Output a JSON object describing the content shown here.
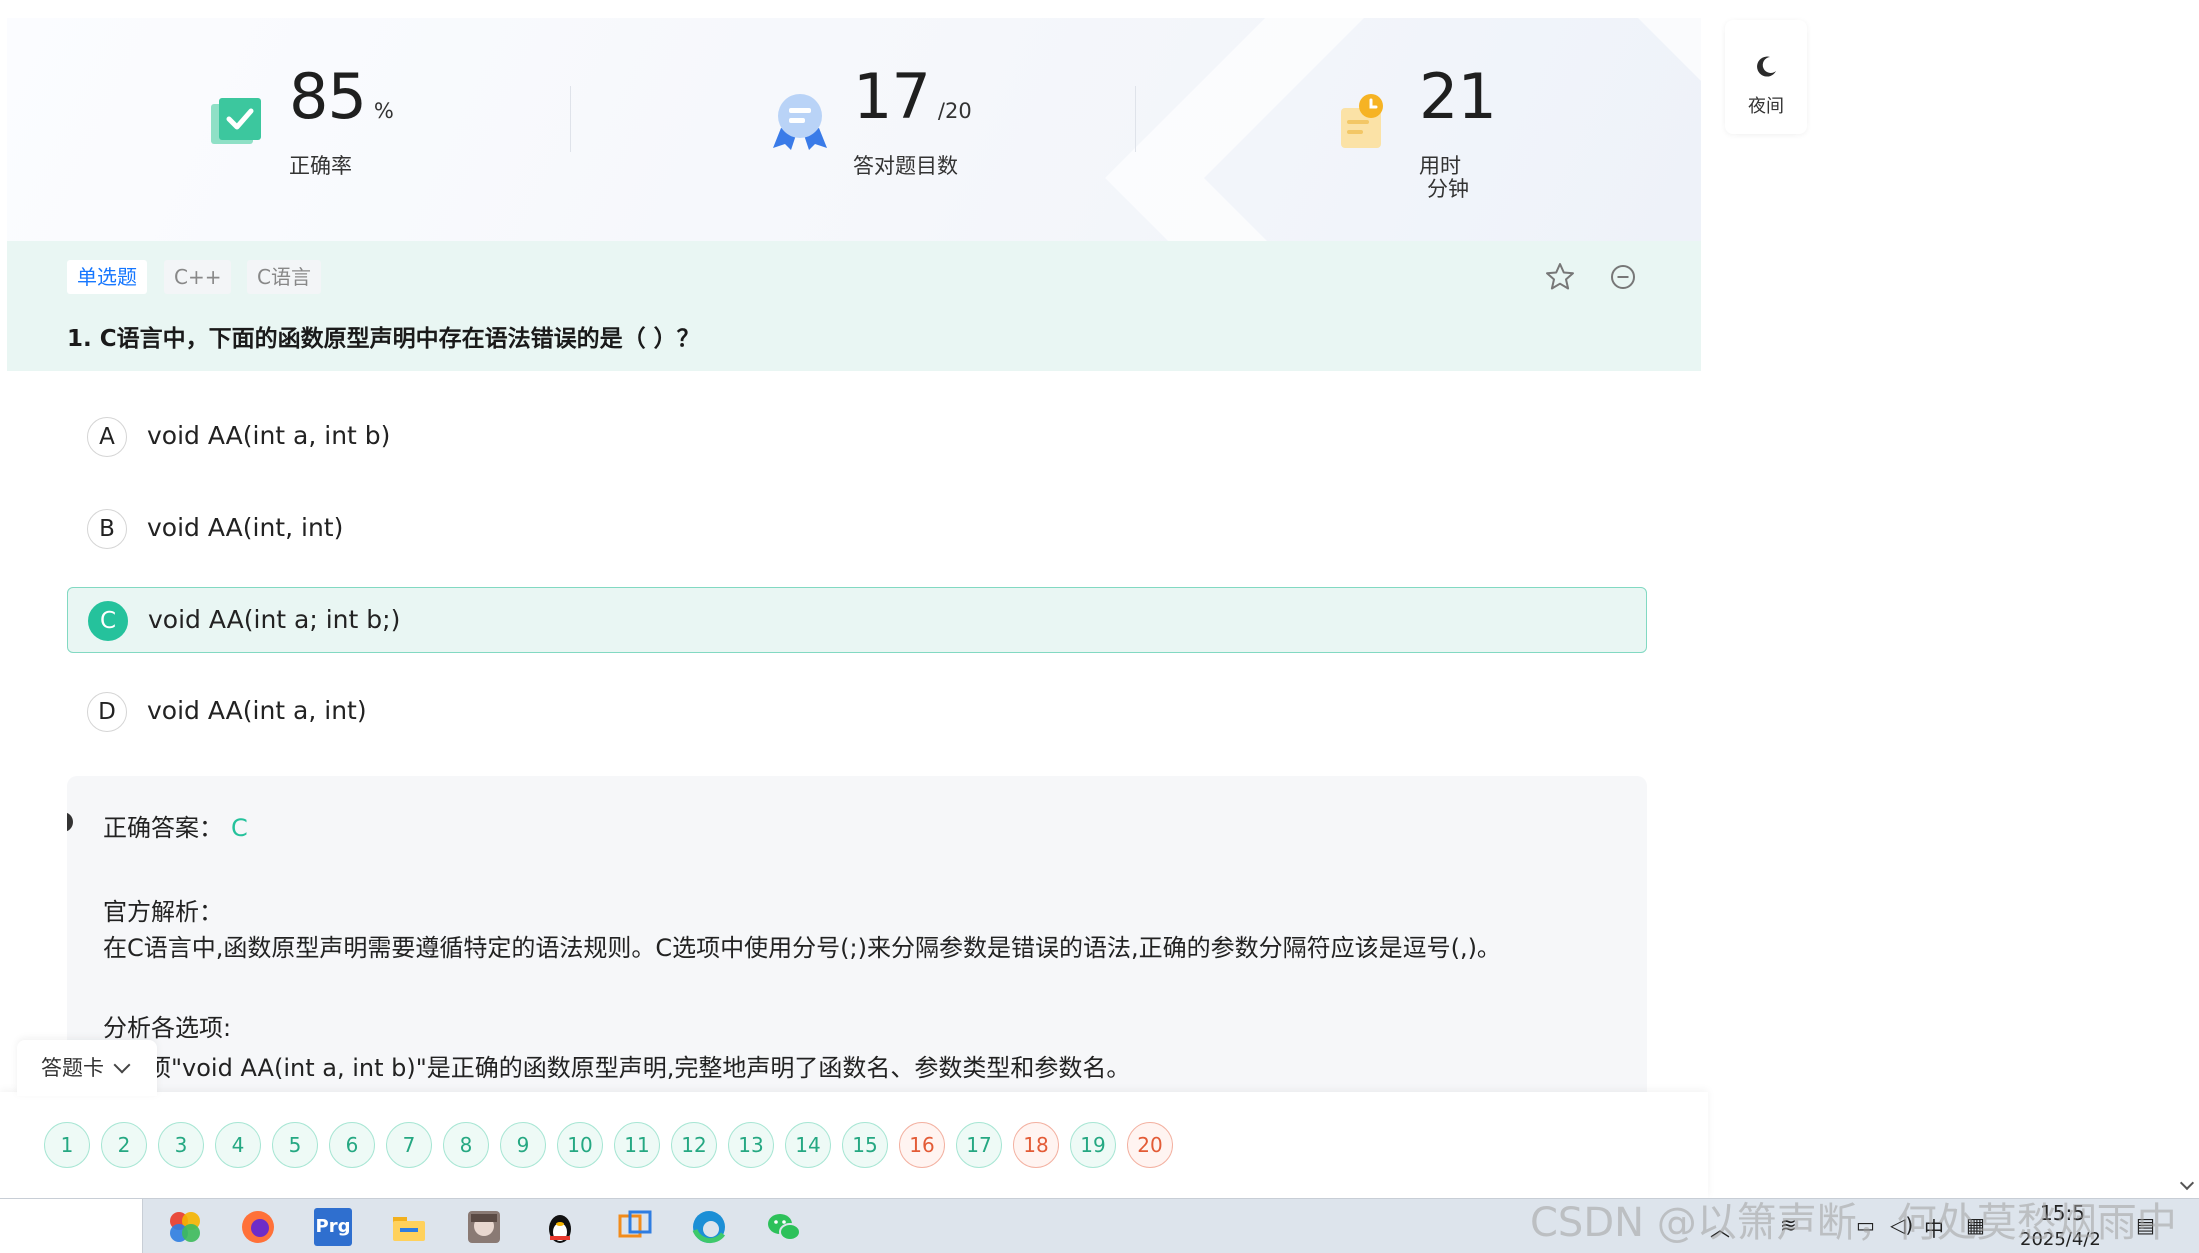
{
  "stats": [
    {
      "value": "85",
      "unit": "%",
      "label": "正确率",
      "icon": "check-book-icon"
    },
    {
      "value": "17",
      "unit": "/20",
      "label": "答对题目数",
      "icon": "award-ribbon-icon"
    },
    {
      "value": "21",
      "unit": "分钟",
      "label": "用时",
      "icon": "clock-note-icon"
    }
  ],
  "night_mode": {
    "label": "夜间",
    "icon": "moon-icon"
  },
  "question": {
    "tags": [
      "单选题",
      "C++",
      "C语言"
    ],
    "title": "1. C语言中，下面的函数原型声明中存在语法错误的是（ ）？",
    "options": [
      {
        "letter": "A",
        "text": "void AA(int a, int b)"
      },
      {
        "letter": "B",
        "text": "void AA(int, int)"
      },
      {
        "letter": "C",
        "text": "void AA(int a; int b;)"
      },
      {
        "letter": "D",
        "text": "void AA(int a, int)"
      }
    ],
    "selected": "C"
  },
  "analysis": {
    "answer_label": "正确答案：",
    "answer_value": "C",
    "official_label": "官方解析：",
    "official_text": "在C语言中,函数原型声明需要遵循特定的语法规则。C选项中使用分号(;)来分隔参数是错误的语法,正确的参数分隔符应该是逗号(,)。",
    "analyze_label": "分析各选项:",
    "line_a": "项\"void AA(int a, int b)\"是正确的函数原型声明,完整地声明了函数名、参数类型和参数名。"
  },
  "answer_card": {
    "label": "答题卡",
    "items": [
      {
        "n": "1",
        "status": "correct"
      },
      {
        "n": "2",
        "status": "correct"
      },
      {
        "n": "3",
        "status": "correct"
      },
      {
        "n": "4",
        "status": "correct"
      },
      {
        "n": "5",
        "status": "correct"
      },
      {
        "n": "6",
        "status": "correct"
      },
      {
        "n": "7",
        "status": "correct"
      },
      {
        "n": "8",
        "status": "correct"
      },
      {
        "n": "9",
        "status": "correct"
      },
      {
        "n": "10",
        "status": "correct"
      },
      {
        "n": "11",
        "status": "correct"
      },
      {
        "n": "12",
        "status": "correct"
      },
      {
        "n": "13",
        "status": "correct"
      },
      {
        "n": "14",
        "status": "correct"
      },
      {
        "n": "15",
        "status": "correct"
      },
      {
        "n": "16",
        "status": "wrong"
      },
      {
        "n": "17",
        "status": "correct"
      },
      {
        "n": "18",
        "status": "wrong"
      },
      {
        "n": "19",
        "status": "correct"
      },
      {
        "n": "20",
        "status": "wrong"
      }
    ]
  },
  "colors": {
    "accent": "#25c29c",
    "wrong": "#e35b36",
    "tag_blue": "#1677ff",
    "header_bg": "#e9f6f3"
  },
  "taskbar": {
    "icons": [
      "color-wheel-icon",
      "firefox-icon",
      "premiere-icon",
      "folder-icon",
      "game-character-icon",
      "qq-penguin-icon",
      "remote-window-icon",
      "edge-icon",
      "wechat-icon"
    ],
    "app_label": "Prg",
    "tray_ime": "中",
    "time": "15:5",
    "date": "2025/4/2"
  },
  "watermark": "CSDN @以箫声断，何处莫愁烟雨中"
}
